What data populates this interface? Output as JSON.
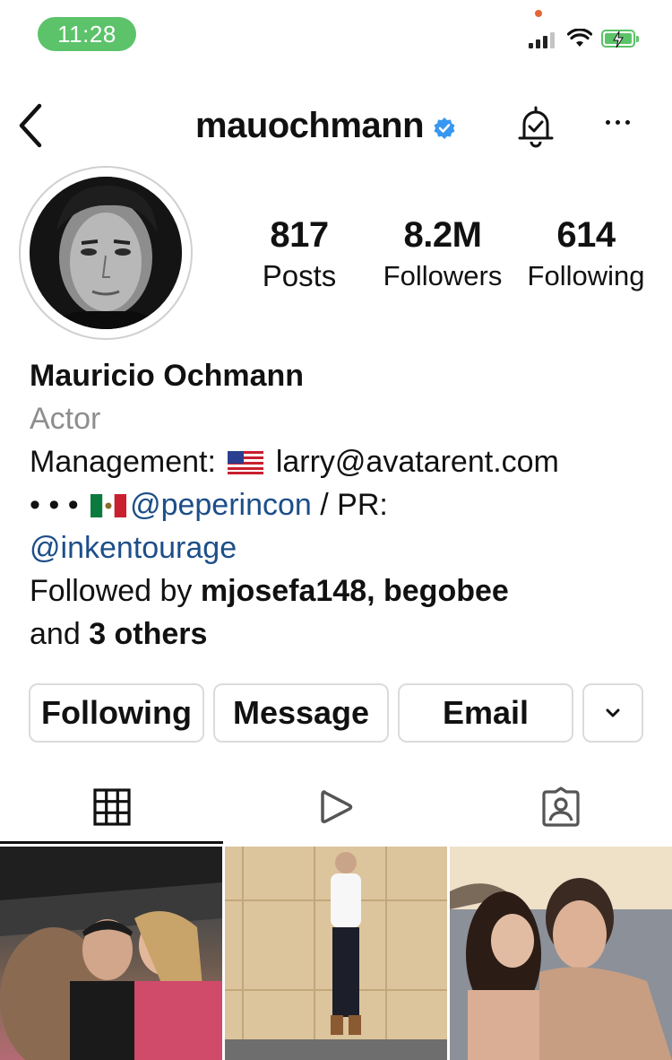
{
  "status_bar": {
    "time": "11:28"
  },
  "header": {
    "username": "mauochmann"
  },
  "profile": {
    "stats": [
      {
        "value": "817",
        "label": "Posts"
      },
      {
        "value": "8.2M",
        "label": "Followers"
      },
      {
        "value": "614",
        "label": "Following"
      }
    ],
    "name": "Mauricio Ochmann",
    "category": "Actor",
    "bio": {
      "management_label": "Management:",
      "management_email": "larry@avatarent.com",
      "dots": "• • •",
      "mention1": "@peperincon",
      "pr_text": " / PR:",
      "mention2": "@inkentourage",
      "followed_by_prefix": "Followed by ",
      "followed_users": "mjosefa148, begobee",
      "and_text": "and ",
      "others": "3 others"
    }
  },
  "buttons": {
    "following": "Following",
    "message": "Message",
    "email": "Email"
  },
  "tabs": [
    "posts-grid",
    "reels",
    "tagged"
  ],
  "colors": {
    "accent_green": "#5cc36a",
    "verified_blue": "#3897f0",
    "link_blue": "#1d4e89"
  }
}
